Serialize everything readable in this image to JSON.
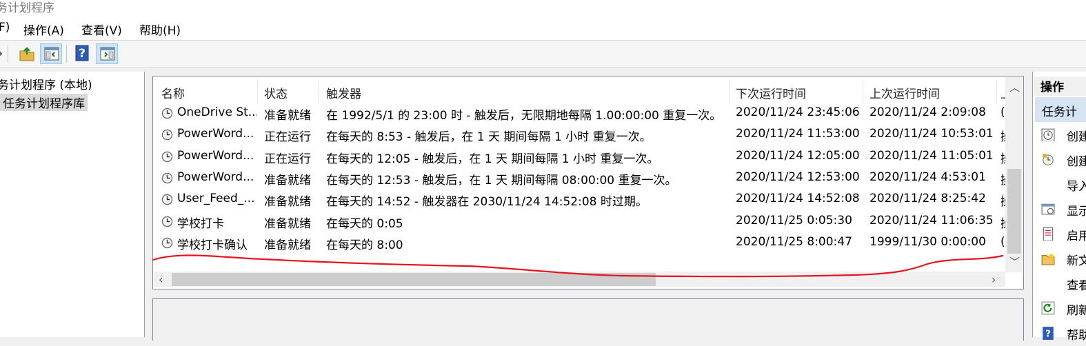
{
  "window": {
    "title": "务计划程序"
  },
  "menu": {
    "file": "F)",
    "action": "操作(A)",
    "view": "查看(V)",
    "help": "帮助(H)"
  },
  "tree": {
    "root": "务计划程序 (本地)",
    "library": "任务计划程序库"
  },
  "columns": {
    "name": "名称",
    "status": "状态",
    "trigger": "触发器",
    "next_run": "下次运行时间",
    "last_run": "上次运行时间",
    "more": "上"
  },
  "tasks": [
    {
      "name": "OneDrive St...",
      "status": "准备就绪",
      "trigger": "在 1992/5/1 的 23:00 时 - 触发后，无限期地每隔 1.00:00:00 重复一次。",
      "next_run": "2020/11/24 23:45:06",
      "last_run": "2020/11/24 2:09:08",
      "extra": "("
    },
    {
      "name": "PowerWord...",
      "status": "正在运行",
      "trigger": "在每天的 8:53 - 触发后，在 1 天 期间每隔 1 小时 重复一次。",
      "next_run": "2020/11/24 11:53:00",
      "last_run": "2020/11/24 10:53:01",
      "extra": "操"
    },
    {
      "name": "PowerWord...",
      "status": "正在运行",
      "trigger": "在每天的 12:05 - 触发后，在 1 天 期间每隔 1 小时 重复一次。",
      "next_run": "2020/11/24 12:05:00",
      "last_run": "2020/11/24 11:05:01",
      "extra": "操"
    },
    {
      "name": "PowerWord...",
      "status": "准备就绪",
      "trigger": "在每天的 12:53 - 触发后，在 1 天 期间每隔 08:00:00 重复一次。",
      "next_run": "2020/11/24 12:53:00",
      "last_run": "2020/11/24 4:53:01",
      "extra": "操"
    },
    {
      "name": "User_Feed_...",
      "status": "准备就绪",
      "trigger": "在每天的 14:52 - 触发器在 2030/11/24 14:52:08 时过期。",
      "next_run": "2020/11/24 14:52:08",
      "last_run": "2020/11/24 8:25:42",
      "extra": "操"
    },
    {
      "name": "学校打卡",
      "status": "准备就绪",
      "trigger": "在每天的 0:05",
      "next_run": "2020/11/25 0:05:30",
      "last_run": "2020/11/24 11:06:35",
      "extra": "操"
    },
    {
      "name": "学校打卡确认",
      "status": "准备就绪",
      "trigger": "在每天的 8:00",
      "next_run": "2020/11/25 8:00:47",
      "last_run": "1999/11/30 0:00:00",
      "extra": "("
    }
  ],
  "actions": {
    "header": "操作",
    "section": "任务计",
    "items": [
      {
        "label": "创建",
        "icon": "create-basic-task-icon"
      },
      {
        "label": "创建",
        "icon": "create-task-icon"
      },
      {
        "label": "导入",
        "icon": ""
      },
      {
        "label": "显示",
        "icon": "show-running-icon"
      },
      {
        "label": "启用",
        "icon": "enable-history-icon"
      },
      {
        "label": "新文",
        "icon": "new-folder-icon"
      },
      {
        "label": "查看",
        "icon": ""
      },
      {
        "label": "刷新",
        "icon": "refresh-icon"
      },
      {
        "label": "帮助",
        "icon": "help-icon"
      }
    ]
  },
  "colors": {
    "selection": "#cce4f7",
    "annotation": "#e8141c",
    "action_highlight": "#d5e3f3"
  }
}
